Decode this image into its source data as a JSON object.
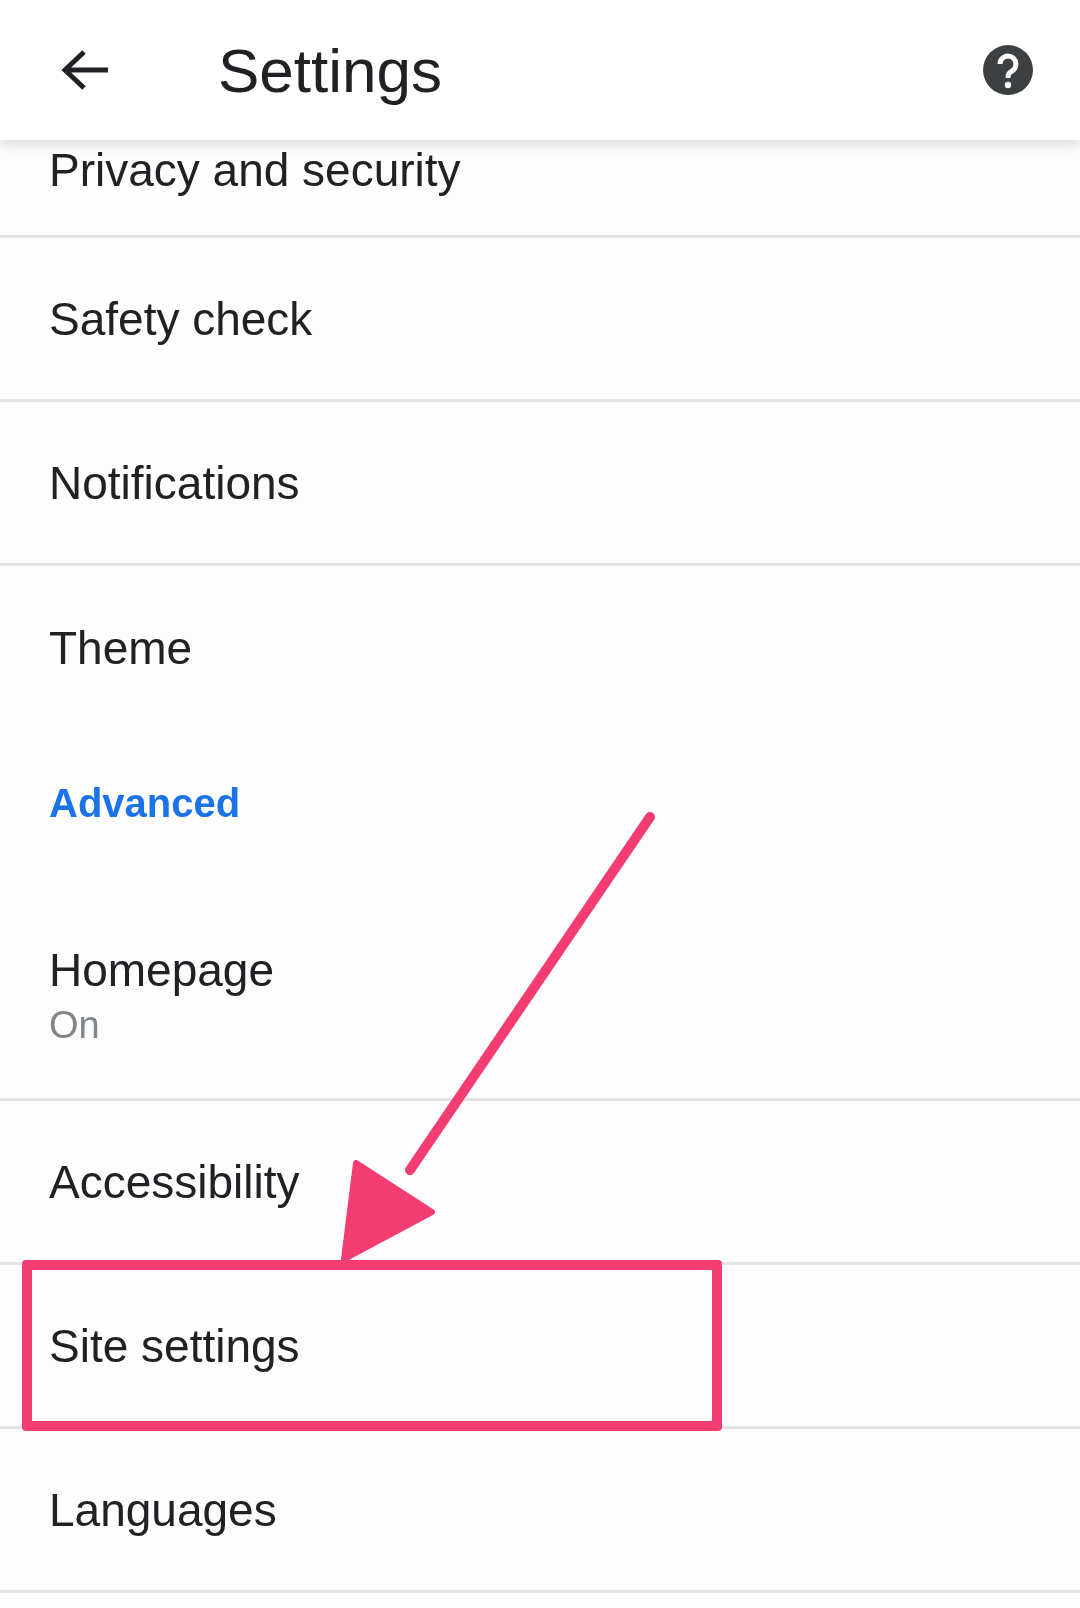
{
  "app_bar": {
    "title": "Settings"
  },
  "rows": [
    {
      "kind": "item",
      "title": "Privacy and security",
      "highlighted": false
    },
    {
      "kind": "item",
      "title": "Safety check",
      "highlighted": false
    },
    {
      "kind": "item",
      "title": "Notifications",
      "highlighted": false
    },
    {
      "kind": "item",
      "title": "Theme",
      "highlighted": false
    },
    {
      "kind": "section",
      "title": "Advanced"
    },
    {
      "kind": "item",
      "title": "Homepage",
      "subtitle": "On",
      "highlighted": false
    },
    {
      "kind": "item",
      "title": "Accessibility",
      "highlighted": false
    },
    {
      "kind": "item",
      "title": "Site settings",
      "highlighted": true
    },
    {
      "kind": "item",
      "title": "Languages",
      "highlighted": false
    }
  ]
}
